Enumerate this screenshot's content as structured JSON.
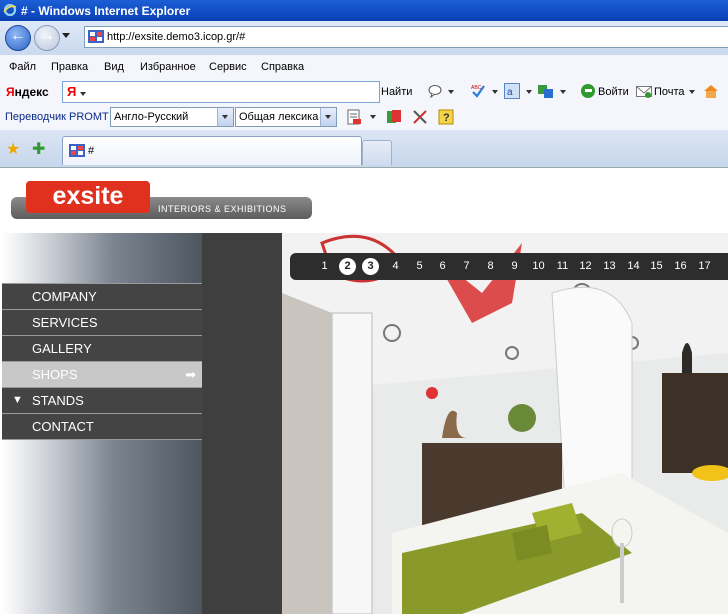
{
  "window": {
    "title": "# - Windows Internet Explorer"
  },
  "address": {
    "url": "http://exsite.demo3.icop.gr/#"
  },
  "menu": [
    "Файл",
    "Правка",
    "Вид",
    "Избранное",
    "Сервис",
    "Справка"
  ],
  "yandex": {
    "logo_prefix": "Я",
    "logo_suffix": "ндекс",
    "input_logo": "Я",
    "find_label": "Найти",
    "login_label": "Войти",
    "mail_label": "Почта"
  },
  "promt": {
    "label": "Переводчик PROMT",
    "direction": "Англо-Русский",
    "dictionary": "Общая лексика"
  },
  "tabs": [
    {
      "label": "#"
    }
  ],
  "site": {
    "logo": "exsite",
    "tagline": "INTERIORS & EXHIBITIONS",
    "menu": [
      {
        "label": "COMPANY"
      },
      {
        "label": "SERVICES"
      },
      {
        "label": "GALLERY"
      },
      {
        "label": "SHOPS",
        "arrow": "➡"
      },
      {
        "label": "STANDS",
        "marker": "▼"
      },
      {
        "label": "CONTACT"
      }
    ],
    "pager": [
      "1",
      "2",
      "3",
      "4",
      "5",
      "6",
      "7",
      "8",
      "9",
      "10",
      "11",
      "12",
      "13",
      "14",
      "15",
      "16",
      "17"
    ],
    "pager_highlighted": [
      "2",
      "3"
    ]
  },
  "colors": {
    "brand_red": "#e0311f",
    "menu_bg": "#444444",
    "menu_active": "#c8c8c8",
    "pager_bg": "#2d2d2d"
  }
}
